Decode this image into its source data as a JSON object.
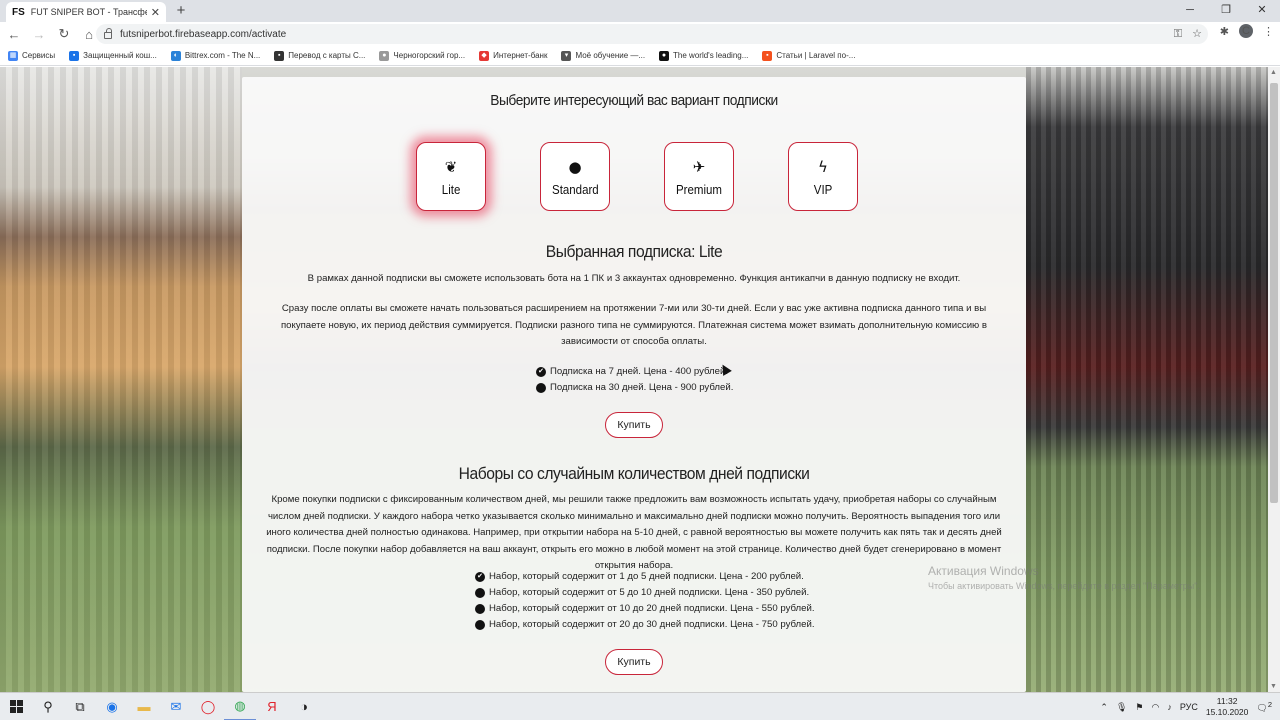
{
  "browser": {
    "tab_favicon": "FS",
    "tab_title": "FUT SNIPER BOT - Трансферный",
    "url": "futsniperbot.firebaseapp.com/activate",
    "profile_initial": "C",
    "bookmarks": [
      {
        "label": "Сервисы",
        "icon_color": "#4285f4"
      },
      {
        "label": "Защищенный кош...",
        "icon_color": "#1a73e8"
      },
      {
        "label": "Bittrex.com - The N...",
        "icon_color": "#2a82d8"
      },
      {
        "label": "Перевод с карты С...",
        "icon_color": "#333333"
      },
      {
        "label": "Черногорский гор...",
        "icon_color": "#999999"
      },
      {
        "label": "Интернет-банк",
        "icon_color": "#e53935"
      },
      {
        "label": "Моё обучение —...",
        "icon_color": "#555555"
      },
      {
        "label": "The world's leading...",
        "icon_color": "#111111"
      },
      {
        "label": "Статьи | Laravel по-...",
        "icon_color": "#f4511e"
      }
    ]
  },
  "page": {
    "heading": "Выберите интересующий вас вариант подписки",
    "plans": [
      {
        "label": "Lite",
        "icon": "feather-icon",
        "glyph": "❦",
        "active": true
      },
      {
        "label": "Standard",
        "icon": "lightbulb-icon",
        "glyph": "●",
        "active": false
      },
      {
        "label": "Premium",
        "icon": "plane-icon",
        "glyph": "✈",
        "active": false
      },
      {
        "label": "VIP",
        "icon": "bolt-icon",
        "glyph": "ϟ",
        "active": false
      }
    ],
    "selected_title": "Выбранная подписка: Lite",
    "selected_desc": "В рамках данной подписки вы сможете использовать бота на 1 ПК и 3 аккаунтах одновременно. Функция антикапчи в данную подписку не входит.",
    "info_text": "Сразу после оплаты вы сможете начать пользоваться расширением на протяжении 7-ми или 30-ти дней. Если у вас уже активна подписка данного типа и вы покупаете новую, их период действия суммируется. Подписки разного типа не суммируются. Платежная система может взимать дополнительную комиссию в зависимости от способа оплаты.",
    "subscription_options": [
      {
        "label": "Подписка на 7 дней. Цена - 400 рублей.",
        "selected": true
      },
      {
        "label": "Подписка на 30 дней. Цена - 900 рублей.",
        "selected": false
      }
    ],
    "buy_label": "Купить",
    "random_heading": "Наборы со случайным количеством дней подписки",
    "random_desc": "Кроме покупки подписки с фиксированным количеством дней, мы решили также предложить вам возможность испытать удачу, приобретая наборы со случайным числом дней подписки. У каждого набора четко указывается сколько минимально и максимально дней подписки можно получить. Вероятность выпадения того или иного количества дней полностью одинакова. Например, при открытии набора на 5-10 дней, с равной вероятностью вы можете получить как пять так и десять дней подписки. После покупки набор добавляется на ваш аккаунт, открыть его можно в любой момент на этой странице. Количество дней будет сгенерировано в момент открытия набора.",
    "random_options": [
      {
        "label": "Набор, который содержит от 1 до 5 дней подписки. Цена - 200 рублей.",
        "selected": true
      },
      {
        "label": "Набор, который содержит от 5 до 10 дней подписки. Цена - 350 рублей.",
        "selected": false
      },
      {
        "label": "Набор, который содержит от 10 до 20 дней подписки. Цена - 550 рублей.",
        "selected": false
      },
      {
        "label": "Набор, который содержит от 20 до 30 дней подписки. Цена - 750 рублей.",
        "selected": false
      }
    ],
    "buy_label_2": "Купить"
  },
  "watermark": {
    "title": "Активация Windows",
    "subtitle": "Чтобы активировать Windows, перейдите в раздел \"Параметры\"."
  },
  "taskbar": {
    "lang": "РУС",
    "time": "11:32",
    "date": "15.10.2020",
    "notification_count": "2"
  }
}
